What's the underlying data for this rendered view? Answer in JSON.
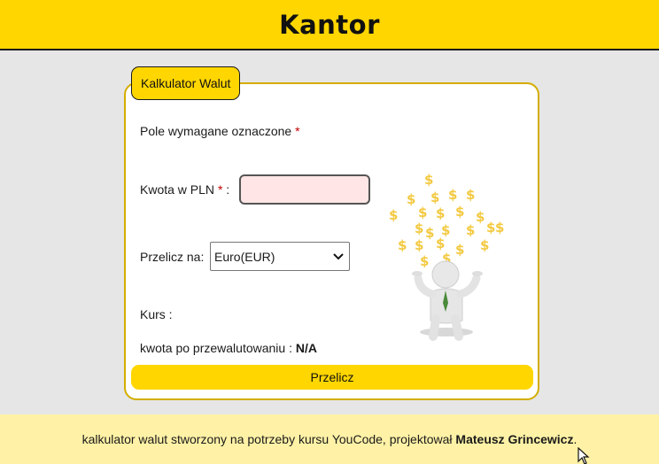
{
  "header": {
    "title": "Kantor"
  },
  "form": {
    "legend": "Kalkulator Walut",
    "required_note": "Pole wymagane oznaczone",
    "required_mark": "*",
    "amount_label": "Kwota w PLN",
    "amount_suffix": " :",
    "amount_value": "",
    "convert_label": "Przelicz na:",
    "currency_selected": "Euro(EUR)",
    "rate_label": "Kurs :",
    "result_label": "kwota po przewalutowaniu :",
    "result_value": "N/A",
    "submit_label": "Przelicz"
  },
  "footer": {
    "text": "kalkulator walut stworzony na potrzeby kursu YouCode, projektował",
    "author": "Mateusz Grincewicz",
    "end": "."
  },
  "colors": {
    "accent": "#ffd600",
    "footer_bg": "#fff2a6",
    "input_bg": "#ffe5e5",
    "dollar": "#f3c941"
  },
  "icons": {
    "select_arrow": "chevron-down-icon",
    "illustration": "money-rain-illustration",
    "cursor": "mouse-pointer-icon"
  }
}
